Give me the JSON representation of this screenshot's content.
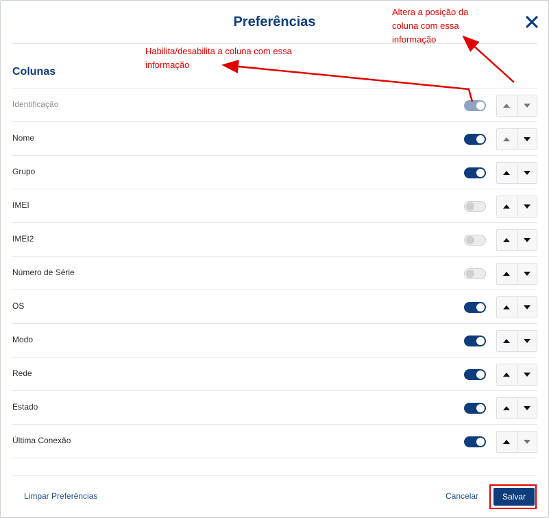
{
  "dialog": {
    "title": "Preferências",
    "section_title": "Colunas",
    "close_icon": "close-icon"
  },
  "columns": [
    {
      "label": "Identificação",
      "enabled": true,
      "locked": true
    },
    {
      "label": "Nome",
      "enabled": true
    },
    {
      "label": "Grupo",
      "enabled": true
    },
    {
      "label": "IMEI",
      "enabled": false
    },
    {
      "label": "IMEI2",
      "enabled": false
    },
    {
      "label": "Número de Série",
      "enabled": false
    },
    {
      "label": "OS",
      "enabled": true
    },
    {
      "label": "Modo",
      "enabled": true
    },
    {
      "label": "Rede",
      "enabled": true
    },
    {
      "label": "Estado",
      "enabled": true
    },
    {
      "label": "Última Conexão",
      "enabled": true
    }
  ],
  "footer": {
    "clear_label": "Limpar Preferências",
    "cancel_label": "Cancelar",
    "save_label": "Salvar"
  },
  "annotations": {
    "toggle_note": "Habilita/desabilita a coluna com essa informação",
    "order_note": "Altera a posição da coluna com essa informação"
  },
  "colors": {
    "primary": "#0f3d7c",
    "annotation": "#e00000",
    "toggle_off": "#ececec"
  }
}
